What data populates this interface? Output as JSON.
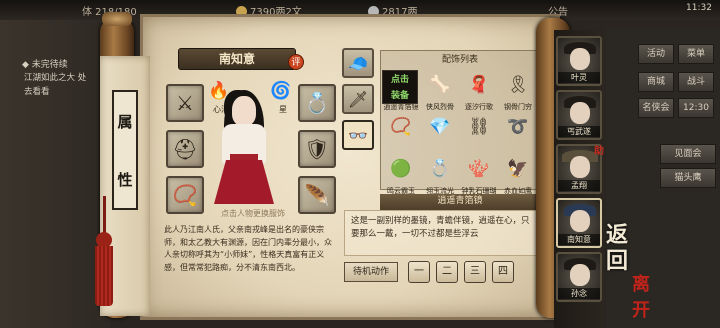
{
  "topbar": {
    "stamina": "体 218/180",
    "copper": "7390两2文",
    "silver": "2817两",
    "notice": "公告",
    "time": "11:32"
  },
  "quest": {
    "title": "未完待续",
    "desc": "江湖如此之大 处去看看"
  },
  "clan": {
    "char1": "属",
    "char2": "性"
  },
  "character": {
    "name": "南知意",
    "badge": "评",
    "hint": "点击人物更换服饰",
    "attr_left_label": "心法",
    "attr_right_label": "星",
    "description": "此人乃江南人氏，父亲南戎峰是出名的豪侠宗师，和太乙教大有渊源，因在门内辈分最小，众人亲切称呼其为“小师妹”，性格天真富有正义感，但常常犯路痴，分不清东南西北。"
  },
  "accessories": {
    "header": "配饰列表",
    "equip_button": "点击\n装备",
    "items": [
      {
        "name": "逍遥青箔镜",
        "icon": "mirror-icon"
      },
      {
        "name": "侠风烈骨",
        "icon": "bones-icon"
      },
      {
        "name": "逐汐行歌",
        "icon": "scarf-icon"
      },
      {
        "name": "钢骨门穷",
        "icon": "belt-icon"
      },
      {
        "name": "",
        "icon": "bracelet-icon"
      },
      {
        "name": "",
        "icon": "necklace-icon"
      },
      {
        "name": "",
        "icon": "chain-icon"
      },
      {
        "name": "",
        "icon": "band-icon"
      },
      {
        "name": "鸣云霸玉",
        "icon": "jade-icon"
      },
      {
        "name": "翎玉流光",
        "icon": "ring-icon"
      },
      {
        "name": "钟乳石珊瑚",
        "icon": "coral-icon"
      },
      {
        "name": "赤血如鹰",
        "icon": "eagle-icon"
      }
    ],
    "selected_title": "逍遥青箔镜",
    "selected_desc": "这是一副别样的墨镜，青蟾伴镜，逍遥在心，只要那么一戴，一切不过都是些浮云",
    "action_label": "待机动作",
    "action_buttons": [
      "一",
      "二",
      "三",
      "四"
    ]
  },
  "portraits": [
    {
      "name": "叶灵",
      "badge": ""
    },
    {
      "name": "丐武遂",
      "badge": ""
    },
    {
      "name": "孟翔",
      "badge": "助"
    },
    {
      "name": "南知意",
      "badge": ""
    },
    {
      "name": "孙念",
      "badge": ""
    }
  ],
  "menu": {
    "buttons": [
      "活动",
      "菜单",
      "商城",
      "战斗",
      "名侠会",
      "12:30"
    ],
    "options": [
      "见面会",
      "猫头鹰"
    ],
    "return_text": "返回",
    "stamp": "离开"
  },
  "colors": {
    "parchment": "#e8dcc0",
    "accent_red": "#a31b2a",
    "equip_green": "#8fd86a"
  }
}
